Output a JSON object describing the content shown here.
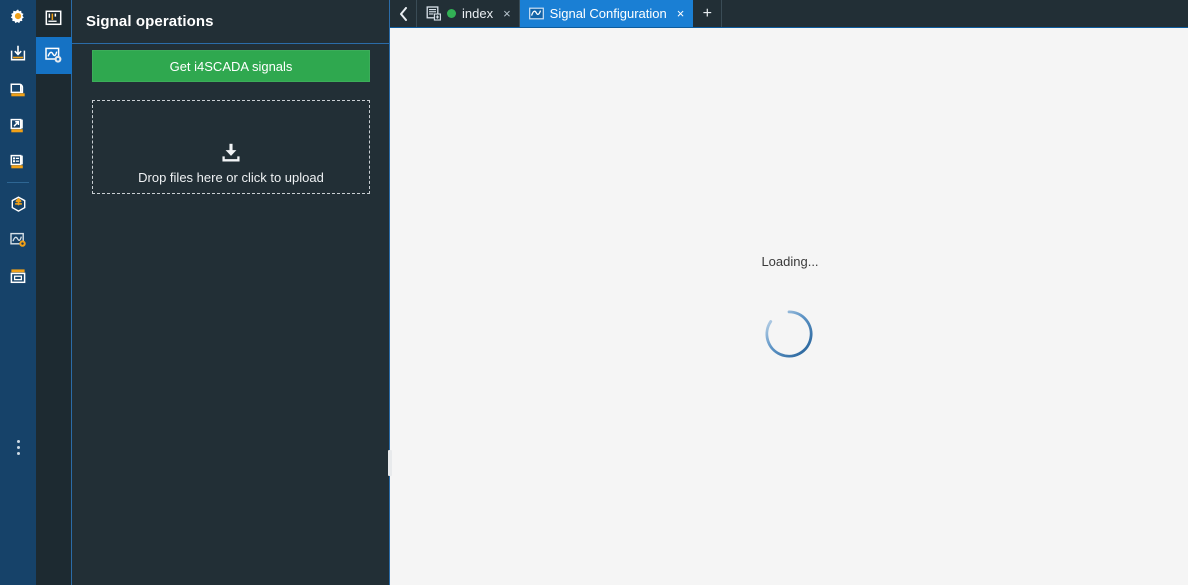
{
  "left_rail": {
    "items": [
      {
        "name": "settings-gear",
        "label": "Settings"
      },
      {
        "name": "import-download",
        "label": "Import"
      },
      {
        "name": "project-folder",
        "label": "Project"
      },
      {
        "name": "export-arrow",
        "label": "Export"
      },
      {
        "name": "report-list",
        "label": "Reports"
      },
      {
        "name": "deploy-package",
        "label": "Deploy"
      },
      {
        "name": "signal-config",
        "label": "Signal Configuration"
      },
      {
        "name": "archive-box",
        "label": "Archive"
      }
    ],
    "overflow_label": "More options"
  },
  "module_rail": {
    "items": [
      {
        "name": "dashboard-widgets",
        "label": "Dashboard",
        "active": false
      },
      {
        "name": "signal-configuration",
        "label": "Signal Configuration",
        "active": true
      }
    ]
  },
  "panel": {
    "title": "Signal operations",
    "get_signals_button": "Get i4SCADA signals",
    "dropzone": {
      "icon": "download-tray-icon",
      "label": "Drop files here or click to upload"
    }
  },
  "tabbar": {
    "back_label": "‹",
    "add_label": "+",
    "close_label": "×",
    "tabs": [
      {
        "label": "index",
        "icon": "page-add-icon",
        "status": "online",
        "status_color": "#32b155",
        "active": false
      },
      {
        "label": "Signal Configuration",
        "icon": "waveform-icon",
        "status": null,
        "active": true
      }
    ]
  },
  "content": {
    "loading_text": "Loading...",
    "spinner_color": "#2f6fad"
  },
  "colors": {
    "rail_blue": "#164269",
    "panel_bg": "#222f36",
    "accent_blue": "#1a7fd4",
    "primary_green": "#2fa84f",
    "content_bg": "#f5f5f5",
    "orange": "#f0a017"
  }
}
